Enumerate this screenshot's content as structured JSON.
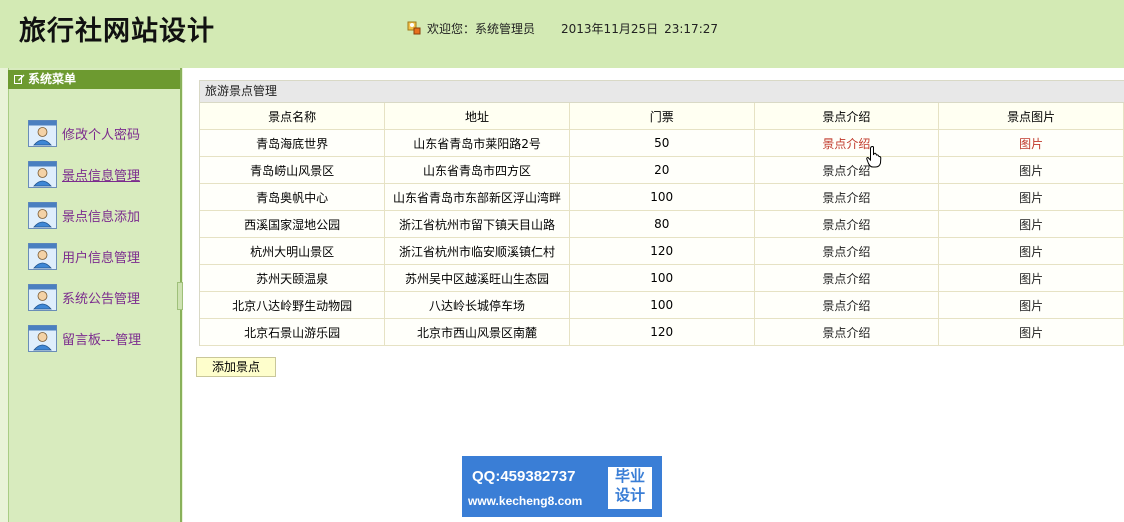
{
  "header": {
    "title": "旅行社网站设计",
    "welcome": "欢迎您：系统管理员",
    "date": "2013年11月25日",
    "time": "23:17:27"
  },
  "sidebar": {
    "title": "系统菜单",
    "items": [
      {
        "label": "修改个人密码",
        "icon": "user-card-icon"
      },
      {
        "label": "景点信息管理",
        "icon": "user-card-icon"
      },
      {
        "label": "景点信息添加",
        "icon": "user-card-icon"
      },
      {
        "label": "用户信息管理",
        "icon": "user-card-icon"
      },
      {
        "label": "系统公告管理",
        "icon": "user-card-icon"
      },
      {
        "label": "留言板---管理",
        "icon": "user-card-icon"
      }
    ]
  },
  "panel": {
    "title": "旅游景点管理",
    "columns": [
      "景点名称",
      "地址",
      "门票",
      "景点介绍",
      "景点图片"
    ],
    "rows": [
      {
        "name": "青岛海底世界",
        "address": "山东省青岛市莱阳路2号",
        "ticket": "50",
        "intro": "景点介绍",
        "pic": "图片"
      },
      {
        "name": "青岛崂山风景区",
        "address": "山东省青岛市四方区",
        "ticket": "20",
        "intro": "景点介绍",
        "pic": "图片"
      },
      {
        "name": "青岛奥帆中心",
        "address": "山东省青岛市东部新区浮山湾畔",
        "ticket": "100",
        "intro": "景点介绍",
        "pic": "图片"
      },
      {
        "name": "西溪国家湿地公园",
        "address": "浙江省杭州市留下镇天目山路",
        "ticket": "80",
        "intro": "景点介绍",
        "pic": "图片"
      },
      {
        "name": "杭州大明山景区",
        "address": "浙江省杭州市临安顺溪镇仁村",
        "ticket": "120",
        "intro": "景点介绍",
        "pic": "图片"
      },
      {
        "name": "苏州天颐温泉",
        "address": "苏州吴中区越溪旺山生态园",
        "ticket": "100",
        "intro": "景点介绍",
        "pic": "图片"
      },
      {
        "name": "北京八达岭野生动物园",
        "address": "八达岭长城停车场",
        "ticket": "100",
        "intro": "景点介绍",
        "pic": "图片"
      },
      {
        "name": "北京石景山游乐园",
        "address": "北京市西山风景区南麓",
        "ticket": "120",
        "intro": "景点介绍",
        "pic": "图片"
      }
    ]
  },
  "add_button": "添加景点",
  "watermark": {
    "qq": "QQ:459382737",
    "url": "www.kecheng8.com",
    "box_line1": "毕业",
    "box_line2": "设计"
  },
  "colors": {
    "header_bg": "#d3eab4",
    "menu_header_bg": "#6d9a30",
    "menu_label": "#7b2b8e",
    "link_hover": "#c0392b",
    "watermark_bg": "#3a7ed6"
  }
}
